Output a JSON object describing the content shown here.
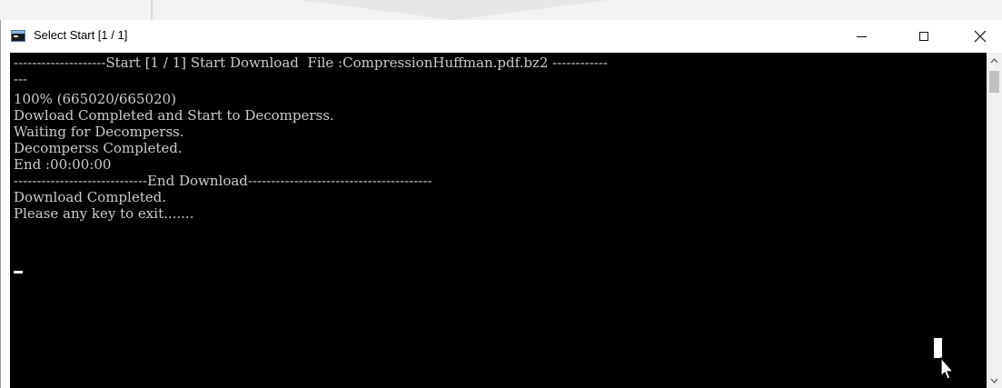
{
  "window": {
    "title": "Select Start [1 / 1]"
  },
  "controls": {
    "minimize_glyph": "—",
    "close_glyph": "✕"
  },
  "console": {
    "lines": [
      "--------------------Start [1 / 1] Start Download  File :CompressionHuffman.pdf.bz2 ------------",
      "---",
      "100% (665020/665020)",
      "Dowload Completed and Start to Decomperss.",
      "Waiting for Decomperss.",
      "Decomperss Completed.",
      "End :00:00:00",
      "-----------------------------End Download----------------------------------------",
      "Download Completed.",
      "Please any key to exit......."
    ]
  },
  "scrollbar": {
    "up_glyph": "▲",
    "down_glyph": "▼"
  },
  "icons": {
    "app": "console-window-icon",
    "minimize": "minimize-icon",
    "maximize": "maximize-icon",
    "close": "close-icon",
    "mouse": "mouse-pointer-icon"
  }
}
